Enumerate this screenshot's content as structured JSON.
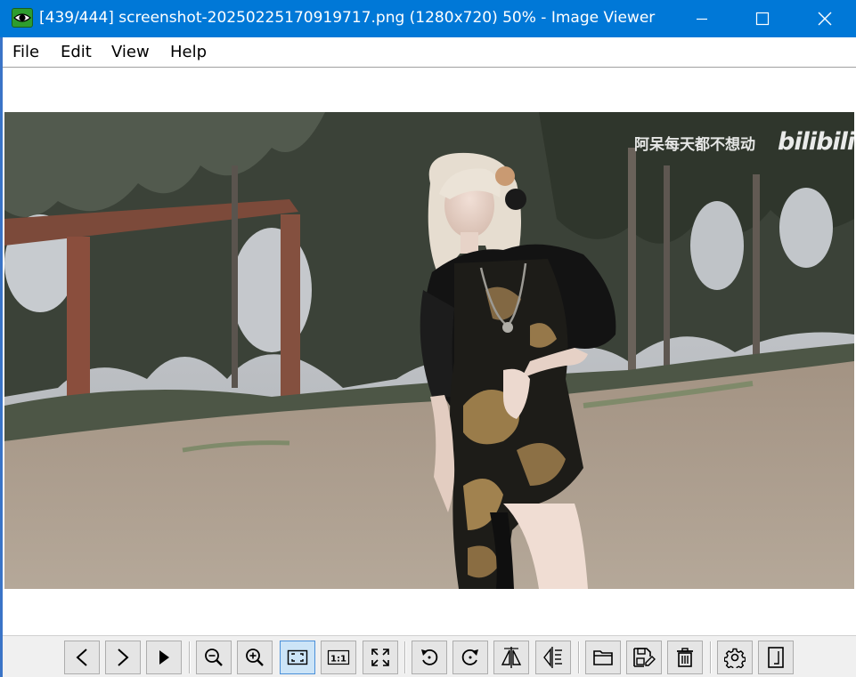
{
  "window": {
    "title": "[439/444] screenshot-20250225170919717.png (1280x720) 50% - Image Viewer",
    "accent_color": "#0078d7",
    "controls": [
      "minimize-icon",
      "maximize-icon",
      "close-icon"
    ]
  },
  "menu": {
    "file": "File",
    "edit": "Edit",
    "view": "View",
    "help": "Help"
  },
  "image": {
    "watermark_text": "阿呆每天都不想动",
    "watermark_logo": "bilibili"
  },
  "toolbar": {
    "buttons": [
      {
        "name": "previous-image-button",
        "icon": "chevron-left-icon"
      },
      {
        "name": "next-image-button",
        "icon": "chevron-right-icon"
      },
      {
        "name": "slideshow-button",
        "icon": "play-icon"
      },
      {
        "name": "zoom-out-button",
        "icon": "zoom-out-icon"
      },
      {
        "name": "zoom-in-button",
        "icon": "zoom-in-icon"
      },
      {
        "name": "fit-to-window-button",
        "icon": "fit-window-icon",
        "active": true
      },
      {
        "name": "actual-size-button",
        "icon": "actual-size-icon",
        "label": "1:1"
      },
      {
        "name": "fullscreen-button",
        "icon": "fullscreen-icon"
      },
      {
        "name": "rotate-left-button",
        "icon": "rotate-left-icon"
      },
      {
        "name": "rotate-right-button",
        "icon": "rotate-right-icon"
      },
      {
        "name": "flip-horizontal-button",
        "icon": "flip-horizontal-icon"
      },
      {
        "name": "flip-vertical-button",
        "icon": "flip-vertical-icon"
      },
      {
        "name": "open-file-button",
        "icon": "folder-icon"
      },
      {
        "name": "save-as-button",
        "icon": "save-edit-icon"
      },
      {
        "name": "delete-button",
        "icon": "trash-icon"
      },
      {
        "name": "settings-button",
        "icon": "gear-icon"
      },
      {
        "name": "about-button",
        "icon": "document-icon"
      }
    ]
  }
}
